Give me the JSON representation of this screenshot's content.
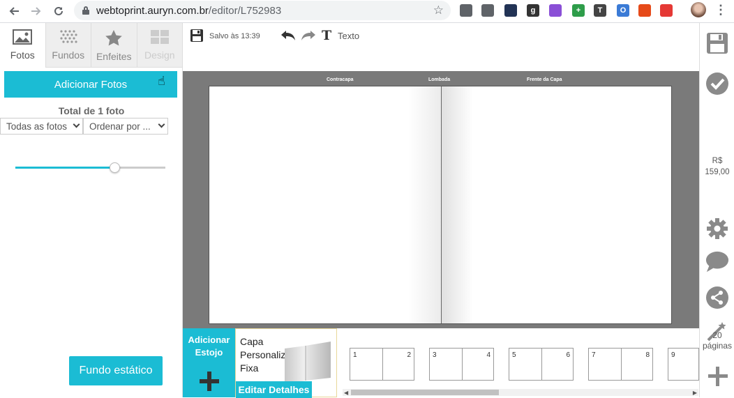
{
  "browser": {
    "url_host": "webtoprint.auryn.com.br",
    "url_path": "/editor/L752983",
    "back_icon": "arrow-left-icon",
    "forward_icon": "arrow-right-icon",
    "reload_icon": "reload-icon",
    "extensions": [
      {
        "name": "screenshot-ext-icon",
        "label": "",
        "color": "#5f6368"
      },
      {
        "name": "camera-ext-icon",
        "label": "",
        "color": "#5f6368"
      },
      {
        "name": "orb-ext-icon",
        "label": "",
        "color": "#223355"
      },
      {
        "name": "grammarly-ext-icon",
        "label": "g",
        "color": "#333333"
      },
      {
        "name": "feather-ext-icon",
        "label": "",
        "color": "#8a4fd6"
      },
      {
        "name": "plus-ext-icon",
        "label": "+",
        "color": "#2e9d4a"
      },
      {
        "name": "t-ext-icon",
        "label": "T",
        "color": "#444444"
      },
      {
        "name": "opera-ext-icon",
        "label": "O",
        "color": "#3b7bd6"
      },
      {
        "name": "puzzle-ext-icon",
        "label": "",
        "color": "#e64a19"
      },
      {
        "name": "cross-ext-icon",
        "label": "",
        "color": "#e53935"
      }
    ]
  },
  "left_panel": {
    "tabs": [
      {
        "label": "Fotos",
        "icon": "image-icon",
        "state": "active"
      },
      {
        "label": "Fundos",
        "icon": "pattern-icon",
        "state": "normal"
      },
      {
        "label": "Enfeites",
        "icon": "star-icon",
        "state": "normal"
      },
      {
        "label": "Design",
        "icon": "layout-icon",
        "state": "disabled"
      }
    ],
    "add_photos_label": "Adicionar Fotos",
    "total_label": "Total de 1 foto",
    "filter_select": "Todas as fotos",
    "order_select": "Ordenar por ...",
    "zoom_slider_value": 0.66,
    "static_background_label": "Fundo estático"
  },
  "toolbar": {
    "saved_label": "Salvo às 13:39",
    "text_label": "Texto"
  },
  "canvas": {
    "back_cover_label": "Contracapa",
    "spine_label": "Lombada",
    "front_cover_label": "Frente da Capa"
  },
  "bottom": {
    "add_case_label": "Adicionar Estojo",
    "cover_title": "Capa Personalizada Fixa",
    "edit_details_label": "Editar Detalhes",
    "pages": [
      {
        "left": "1",
        "right": "2"
      },
      {
        "left": "3",
        "right": "4"
      },
      {
        "left": "5",
        "right": "6"
      },
      {
        "left": "7",
        "right": "8"
      },
      {
        "left": "9",
        "right": ""
      }
    ]
  },
  "right_panel": {
    "currency": "R$",
    "price": "159,00",
    "pages_count": "20",
    "pages_label": "páginas"
  },
  "colors": {
    "accent": "#1bbcd4",
    "canvas_bg": "#7a7a7a",
    "icon_gray": "#8a8a8a"
  }
}
